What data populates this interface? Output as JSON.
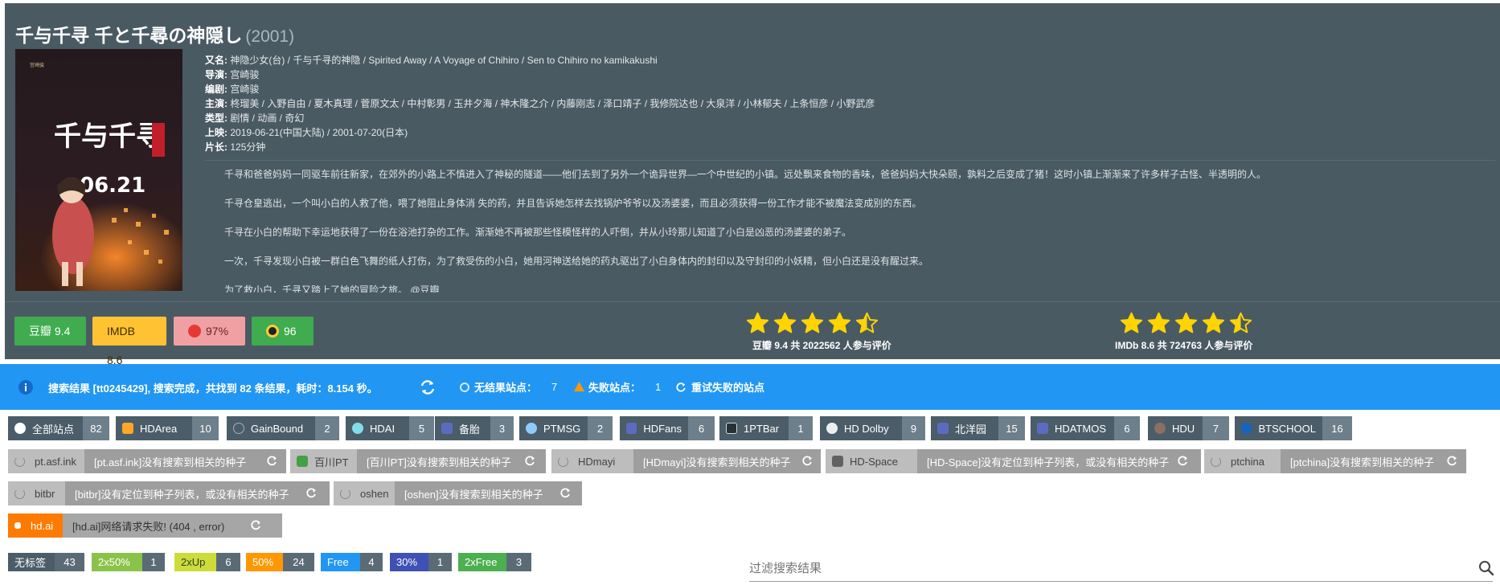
{
  "movie": {
    "title": "千与千寻 千と千尋の神隠し",
    "year": "(2001)",
    "poster": {
      "title_text": "千与千寻",
      "date_text": "06.21"
    },
    "info": [
      {
        "key": "又名:",
        "value": "神隐少女(台) / 千与千寻的神隐 / Spirited Away / A Voyage of Chihiro / Sen to Chihiro no kamikakushi"
      },
      {
        "key": "导演:",
        "value": "宫崎骏"
      },
      {
        "key": "编剧:",
        "value": "宫崎骏"
      },
      {
        "key": "主演:",
        "value": "柊瑠美 / 入野自由 / 夏木真理 / 菅原文太 / 中村彰男 / 玉井夕海 / 神木隆之介 / 内藤刚志 / 泽口靖子 / 我修院达也 / 大泉洋 / 小林郁夫 / 上条恒彦 / 小野武彦"
      },
      {
        "key": "类型:",
        "value": "剧情 / 动画 / 奇幻"
      },
      {
        "key": "上映:",
        "value": "2019-06-21(中国大陆) / 2001-07-20(日本)"
      },
      {
        "key": "片长:",
        "value": "125分钟"
      }
    ],
    "summary": [
      "千寻和爸爸妈妈一同驱车前往新家，在郊外的小路上不慎进入了神秘的隧道——他们去到了另外一个诡异世界—一个中世纪的小镇。远处飘来食物的香味，爸爸妈妈大快朵颐，孰料之后变成了猪！这时小镇上渐渐来了许多样子古怪、半透明的人。",
      "千寻仓皇逃出，一个叫小白的人救了他，喂了她阻止身体消 失的药，并且告诉她怎样去找锅炉爷爷以及汤婆婆，而且必须获得一份工作才能不被魔法变成别的东西。",
      "千寻在小白的帮助下幸运地获得了一份在浴池打杂的工作。渐渐她不再被那些怪模怪样的人吓倒，并从小玲那儿知道了小白是凶恶的汤婆婆的弟子。",
      "一次，千寻发现小白被一群白色飞舞的纸人打伤，为了救受伤的小白，她用河神送给她的药丸驱出了小白身体内的封印以及守封印的小妖精，但小白还是没有醒过来。",
      "为了救小白，千寻又踏上了她的冒险之旅。 @豆瓣"
    ],
    "scores": {
      "douban": "豆瓣 9.4",
      "imdb": "IMDB 8.6",
      "tomato": "97%",
      "metacritic": "96"
    },
    "ratings": {
      "douban_text": "豆瓣 9.4 共 2022562 人参与评价",
      "douban_stars": 4.5,
      "imdb_text": "IMDb 8.6 共 724763 人参与评价",
      "imdb_stars": 4.5,
      "star_color": "#ffd400"
    }
  },
  "status": {
    "result_text": "搜索结果 [tt0245429], 搜索完成，共找到 82 条结果，耗时：8.154 秒。",
    "no_result_label": "无结果站点：",
    "no_result_count": "7",
    "failed_label": "失败站点：",
    "failed_count": "1",
    "retry_label": "重试失败的站点"
  },
  "sites": [
    {
      "name": "全部站点",
      "count": "82"
    },
    {
      "name": "HDArea",
      "count": "10"
    },
    {
      "name": "GainBound",
      "count": "2"
    },
    {
      "name": "HDAI",
      "count": "5"
    },
    {
      "name": "备胎",
      "count": "3"
    },
    {
      "name": "PTMSG",
      "count": "2"
    },
    {
      "name": "HDFans",
      "count": "6"
    },
    {
      "name": "1PTBar",
      "count": "1"
    },
    {
      "name": "HD Dolby",
      "count": "9"
    },
    {
      "name": "北洋园",
      "count": "15"
    },
    {
      "name": "HDATMOS",
      "count": "6"
    },
    {
      "name": "HDU",
      "count": "7"
    },
    {
      "name": "BTSCHOOL",
      "count": "16"
    }
  ],
  "errors": [
    {
      "name": "pt.asf.ink",
      "msg": "[pt.asf.ink]没有搜索到相关的种子"
    },
    {
      "name": "百川PT",
      "msg": "[百川PT]没有搜索到相关的种子"
    },
    {
      "name": "HDmayi",
      "msg": "[HDmayi]没有搜索到相关的种子"
    },
    {
      "name": "HD-Space",
      "msg": "[HD-Space]没有定位到种子列表，或没有相关的种子"
    },
    {
      "name": "ptchina",
      "msg": "[ptchina]没有搜索到相关的种子"
    },
    {
      "name": "bitbr",
      "msg": "[bitbr]没有定位到种子列表，或没有相关的种子"
    },
    {
      "name": "oshen",
      "msg": "[oshen]没有搜索到相关的种子"
    },
    {
      "name": "hd.ai",
      "msg": "[hd.ai]网络请求失败! (404 , error)"
    }
  ],
  "tags": [
    {
      "name": "无标签",
      "count": "43",
      "color": "#4a5d69"
    },
    {
      "name": "2x50%",
      "count": "1",
      "color": "#8bc34a"
    },
    {
      "name": "2xUp",
      "count": "6",
      "color": "#cddc39"
    },
    {
      "name": "50%",
      "count": "24",
      "color": "#ff9800"
    },
    {
      "name": "Free",
      "count": "4",
      "color": "#2196f3"
    },
    {
      "name": "30%",
      "count": "1",
      "color": "#3f51b5"
    },
    {
      "name": "2xFree",
      "count": "3",
      "color": "#4caf50"
    }
  ],
  "filter": {
    "placeholder": "过滤搜索结果"
  }
}
